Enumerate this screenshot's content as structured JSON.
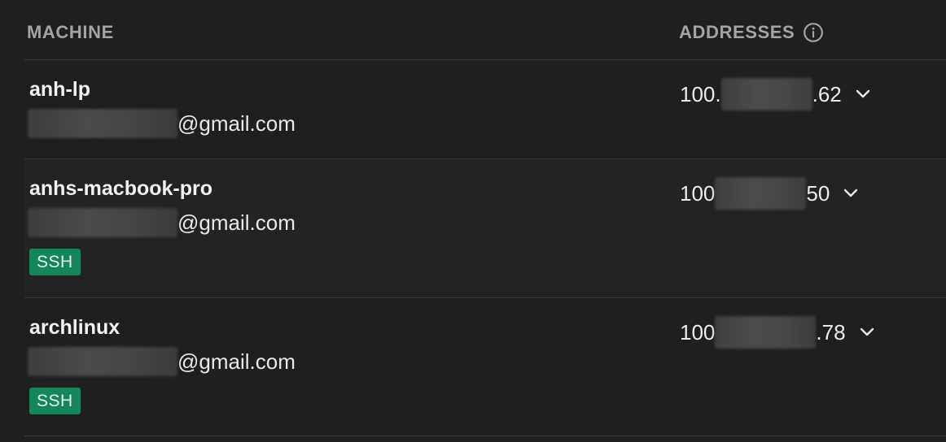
{
  "header": {
    "machine_label": "MACHINE",
    "addresses_label": "ADDRESSES"
  },
  "machines": [
    {
      "name": "anh-lp",
      "email_suffix": "@gmail.com",
      "address_prefix": "100.",
      "address_suffix": ".62",
      "badge": null
    },
    {
      "name": "anhs-macbook-pro",
      "email_suffix": "@gmail.com",
      "address_prefix": "100",
      "address_suffix": "50",
      "badge": "SSH"
    },
    {
      "name": "archlinux",
      "email_suffix": "@gmail.com",
      "address_prefix": "100",
      "address_suffix": ".78",
      "badge": "SSH"
    }
  ],
  "colors": {
    "background": "#1f1f1f",
    "header_text": "#a4a4a4",
    "badge_bg": "#15855a",
    "divider": "#3a3a3a"
  },
  "icons": {
    "info": "info-icon",
    "expand": "chevron-down-icon"
  }
}
